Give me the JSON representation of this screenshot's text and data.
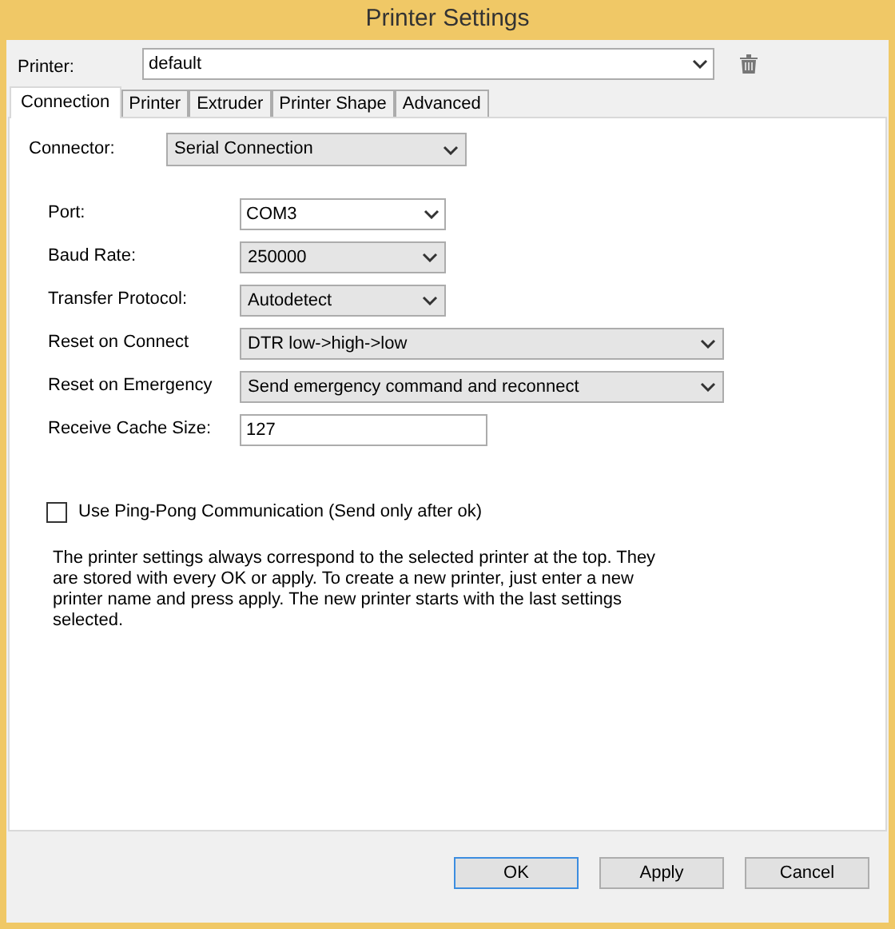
{
  "window": {
    "title": "Printer Settings"
  },
  "printer": {
    "label": "Printer:",
    "value": "default"
  },
  "tabs": [
    {
      "label": "Connection",
      "selected": true
    },
    {
      "label": "Printer",
      "selected": false
    },
    {
      "label": "Extruder",
      "selected": false
    },
    {
      "label": "Printer Shape",
      "selected": false
    },
    {
      "label": "Advanced",
      "selected": false
    }
  ],
  "connector": {
    "label": "Connector:",
    "value": "Serial Connection"
  },
  "fields": [
    {
      "label": "Port:",
      "kind": "combo",
      "value": "COM3"
    },
    {
      "label": "Baud Rate:",
      "kind": "dropdown",
      "value": "250000"
    },
    {
      "label": "Transfer Protocol:",
      "kind": "dropdown",
      "value": "Autodetect"
    },
    {
      "label": "Reset on Connect",
      "kind": "dropdown",
      "value": "DTR low->high->low"
    },
    {
      "label": "Reset on Emergency",
      "kind": "dropdown",
      "value": "Send emergency command and reconnect"
    },
    {
      "label": "Receive Cache Size:",
      "kind": "text",
      "value": "127"
    }
  ],
  "ping_pong": {
    "label": "Use Ping-Pong Communication (Send only after ok)",
    "checked": false
  },
  "note": "The printer settings always correspond to the selected printer at the top. They are stored with every OK or apply. To create a new printer, just enter a new printer name and press apply. The new printer starts with the last settings selected.",
  "buttons": [
    {
      "label": "OK",
      "default": true
    },
    {
      "label": "Apply",
      "default": false
    },
    {
      "label": "Cancel",
      "default": false
    }
  ]
}
